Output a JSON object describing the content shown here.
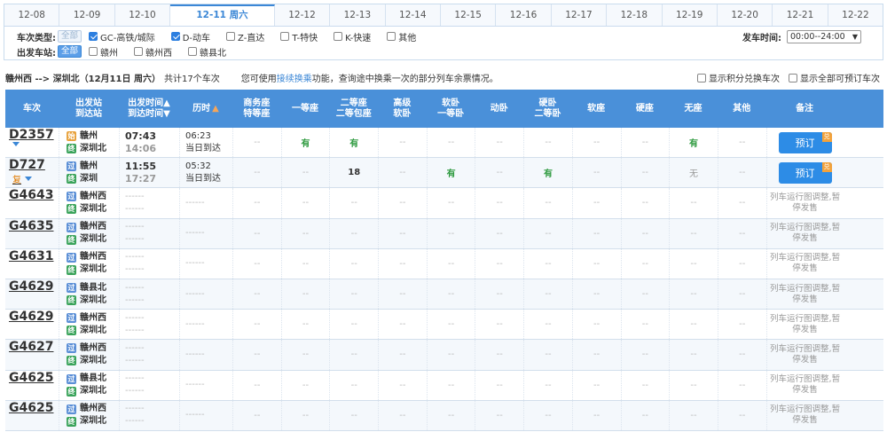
{
  "date_tabs": [
    {
      "label": "12-08",
      "active": false
    },
    {
      "label": "12-09",
      "active": false
    },
    {
      "label": "12-10",
      "active": false
    },
    {
      "label": "12-11 周六",
      "active": true
    },
    {
      "label": "12-12",
      "active": false
    },
    {
      "label": "12-13",
      "active": false
    },
    {
      "label": "12-14",
      "active": false
    },
    {
      "label": "12-15",
      "active": false
    },
    {
      "label": "12-16",
      "active": false
    },
    {
      "label": "12-17",
      "active": false
    },
    {
      "label": "12-18",
      "active": false
    },
    {
      "label": "12-19",
      "active": false
    },
    {
      "label": "12-20",
      "active": false
    },
    {
      "label": "12-21",
      "active": false
    },
    {
      "label": "12-22",
      "active": false
    }
  ],
  "filters": {
    "train_type_label": "车次类型:",
    "all_label": "全部",
    "train_types": [
      {
        "label": "GC-高铁/城际",
        "checked": true
      },
      {
        "label": "D-动车",
        "checked": true
      },
      {
        "label": "Z-直达",
        "checked": false
      },
      {
        "label": "T-特快",
        "checked": false
      },
      {
        "label": "K-快速",
        "checked": false
      },
      {
        "label": "其他",
        "checked": false
      }
    ],
    "station_label": "出发车站:",
    "stations": [
      {
        "label": "赣州",
        "checked": false
      },
      {
        "label": "赣州西",
        "checked": false
      },
      {
        "label": "赣县北",
        "checked": false
      }
    ],
    "depart_label": "发车时间:",
    "depart_value": "00:00--24:00"
  },
  "summary": {
    "route": "赣州西 --> 深圳北（12月11日 周六）",
    "count": "共计17个车次",
    "hint_prefix": "您可使用",
    "hint_link": "接续换乘",
    "hint_suffix": "功能，查询途中换乘一次的部分列车余票情况。",
    "opt1": "显示积分兑换车次",
    "opt2": "显示全部可预订车次"
  },
  "headers": {
    "train": "车次",
    "station": [
      "出发站",
      "到达站"
    ],
    "time": [
      "出发时间▲",
      "到达时间▼"
    ],
    "duration": "历时",
    "business": [
      "商务座",
      "特等座"
    ],
    "first": "一等座",
    "second": [
      "二等座",
      "二等包座"
    ],
    "adv_soft": [
      "高级",
      "软卧"
    ],
    "soft_first": [
      "软卧",
      "一等卧"
    ],
    "moving": "动卧",
    "hard_second": [
      "硬卧",
      "二等卧"
    ],
    "soft_seat": "软座",
    "hard_seat": "硬座",
    "no_seat": "无座",
    "other": "其他",
    "note": "备注"
  },
  "book_label": "预订",
  "book_corner": "兑",
  "badges": {
    "start": "始",
    "pass": "过",
    "end": "终"
  },
  "rows": [
    {
      "train": "D2357",
      "fu": "",
      "from": "赣州",
      "from_type": "start",
      "to": "深圳北",
      "to_type": "end",
      "dep": "07:43",
      "arr": "14:06",
      "dur": "06:23",
      "day": "当日到达",
      "seats": [
        "--",
        "有",
        "有",
        "--",
        "--",
        "--",
        "--",
        "--",
        "--",
        "有",
        "--"
      ],
      "bookable": true,
      "note": ""
    },
    {
      "train": "D727",
      "fu": "复",
      "from": "赣州",
      "from_type": "pass",
      "to": "深圳",
      "to_type": "end",
      "dep": "11:55",
      "arr": "17:27",
      "dur": "05:32",
      "day": "当日到达",
      "seats": [
        "--",
        "--",
        "18",
        "--",
        "有",
        "--",
        "有",
        "--",
        "--",
        "无",
        "--"
      ],
      "bookable": true,
      "note": ""
    },
    {
      "train": "G4643",
      "fu": "",
      "from": "赣州西",
      "from_type": "pass",
      "to": "深圳北",
      "to_type": "end",
      "dep": "------",
      "arr": "------",
      "dur": "------",
      "day": "",
      "seats": [
        "--",
        "--",
        "--",
        "--",
        "--",
        "--",
        "--",
        "--",
        "--",
        "--",
        "--"
      ],
      "bookable": false,
      "note": "列车运行图调整,暂停发售"
    },
    {
      "train": "G4635",
      "fu": "",
      "from": "赣州西",
      "from_type": "pass",
      "to": "深圳北",
      "to_type": "end",
      "dep": "------",
      "arr": "------",
      "dur": "------",
      "day": "",
      "seats": [
        "--",
        "--",
        "--",
        "--",
        "--",
        "--",
        "--",
        "--",
        "--",
        "--",
        "--"
      ],
      "bookable": false,
      "note": "列车运行图调整,暂停发售"
    },
    {
      "train": "G4631",
      "fu": "",
      "from": "赣州西",
      "from_type": "pass",
      "to": "深圳北",
      "to_type": "end",
      "dep": "------",
      "arr": "------",
      "dur": "------",
      "day": "",
      "seats": [
        "--",
        "--",
        "--",
        "--",
        "--",
        "--",
        "--",
        "--",
        "--",
        "--",
        "--"
      ],
      "bookable": false,
      "note": "列车运行图调整,暂停发售"
    },
    {
      "train": "G4629",
      "fu": "",
      "from": "赣县北",
      "from_type": "pass",
      "to": "深圳北",
      "to_type": "end",
      "dep": "------",
      "arr": "------",
      "dur": "------",
      "day": "",
      "seats": [
        "--",
        "--",
        "--",
        "--",
        "--",
        "--",
        "--",
        "--",
        "--",
        "--",
        "--"
      ],
      "bookable": false,
      "note": "列车运行图调整,暂停发售"
    },
    {
      "train": "G4629",
      "fu": "",
      "from": "赣州西",
      "from_type": "pass",
      "to": "深圳北",
      "to_type": "end",
      "dep": "------",
      "arr": "------",
      "dur": "------",
      "day": "",
      "seats": [
        "--",
        "--",
        "--",
        "--",
        "--",
        "--",
        "--",
        "--",
        "--",
        "--",
        "--"
      ],
      "bookable": false,
      "note": "列车运行图调整,暂停发售"
    },
    {
      "train": "G4627",
      "fu": "",
      "from": "赣州西",
      "from_type": "pass",
      "to": "深圳北",
      "to_type": "end",
      "dep": "------",
      "arr": "------",
      "dur": "------",
      "day": "",
      "seats": [
        "--",
        "--",
        "--",
        "--",
        "--",
        "--",
        "--",
        "--",
        "--",
        "--",
        "--"
      ],
      "bookable": false,
      "note": "列车运行图调整,暂停发售"
    },
    {
      "train": "G4625",
      "fu": "",
      "from": "赣县北",
      "from_type": "pass",
      "to": "深圳北",
      "to_type": "end",
      "dep": "------",
      "arr": "------",
      "dur": "------",
      "day": "",
      "seats": [
        "--",
        "--",
        "--",
        "--",
        "--",
        "--",
        "--",
        "--",
        "--",
        "--",
        "--"
      ],
      "bookable": false,
      "note": "列车运行图调整,暂停发售"
    },
    {
      "train": "G4625",
      "fu": "",
      "from": "赣州西",
      "from_type": "pass",
      "to": "深圳北",
      "to_type": "end",
      "dep": "------",
      "arr": "------",
      "dur": "------",
      "day": "",
      "seats": [
        "--",
        "--",
        "--",
        "--",
        "--",
        "--",
        "--",
        "--",
        "--",
        "--",
        "--"
      ],
      "bookable": false,
      "note": "列车运行图调整,暂停发售"
    }
  ]
}
